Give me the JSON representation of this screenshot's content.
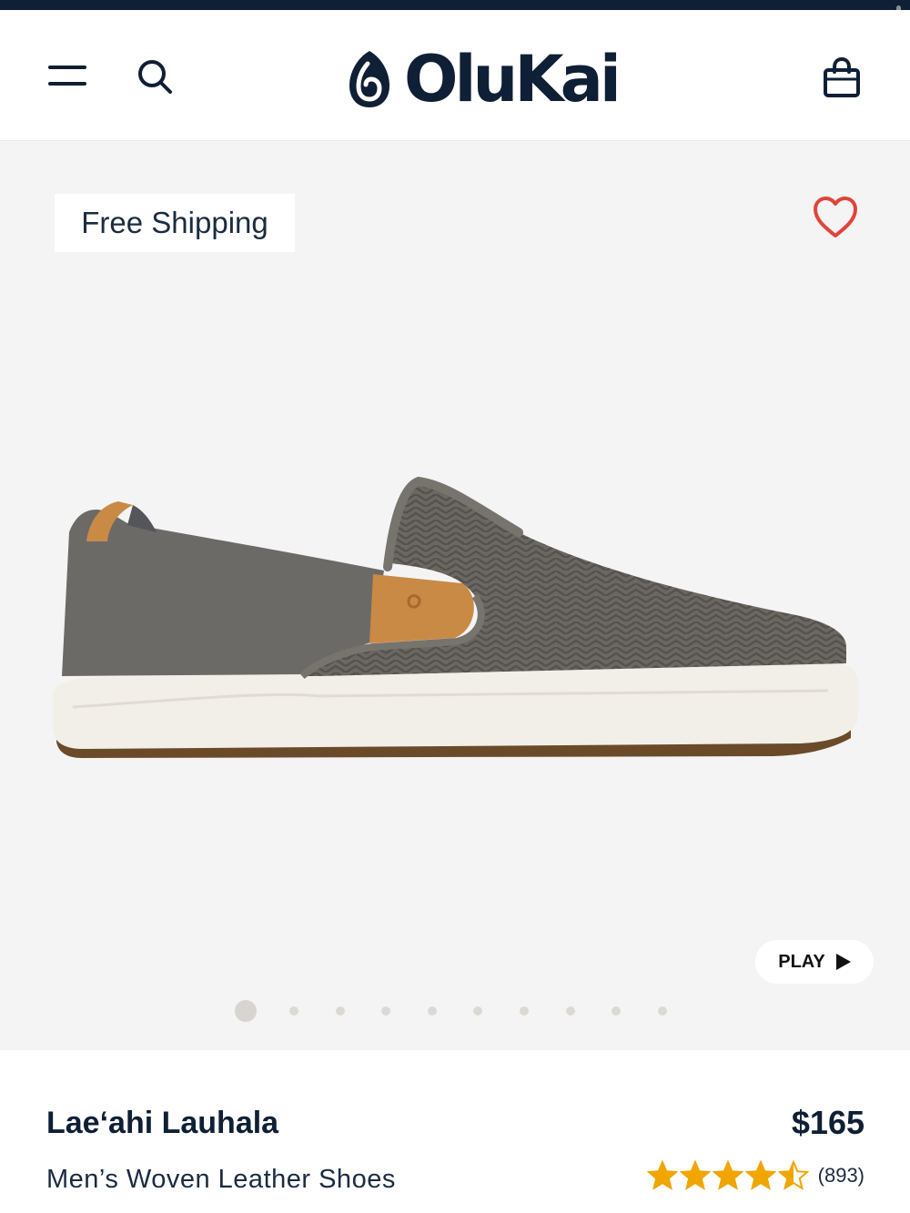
{
  "header": {
    "brand": "OluKai",
    "menu_icon": "hamburger-menu-icon",
    "search_icon": "search-icon",
    "bag_icon": "shopping-bag-icon"
  },
  "gallery": {
    "badge": "Free Shipping",
    "favorite_icon": "heart-icon",
    "play_label": "PLAY",
    "slide_count": 10,
    "active_slide": 1
  },
  "product": {
    "name": "Lae‘ahi Lauhala",
    "subtitle": "Men’s Woven Leather Shoes",
    "price": "$165",
    "rating": 4.5,
    "review_count": "(893)"
  },
  "colors": {
    "brand_navy": "#0f1f35",
    "heart_red": "#e0443a",
    "star_gold": "#f0a500",
    "gallery_bg": "#f4f4f4"
  }
}
